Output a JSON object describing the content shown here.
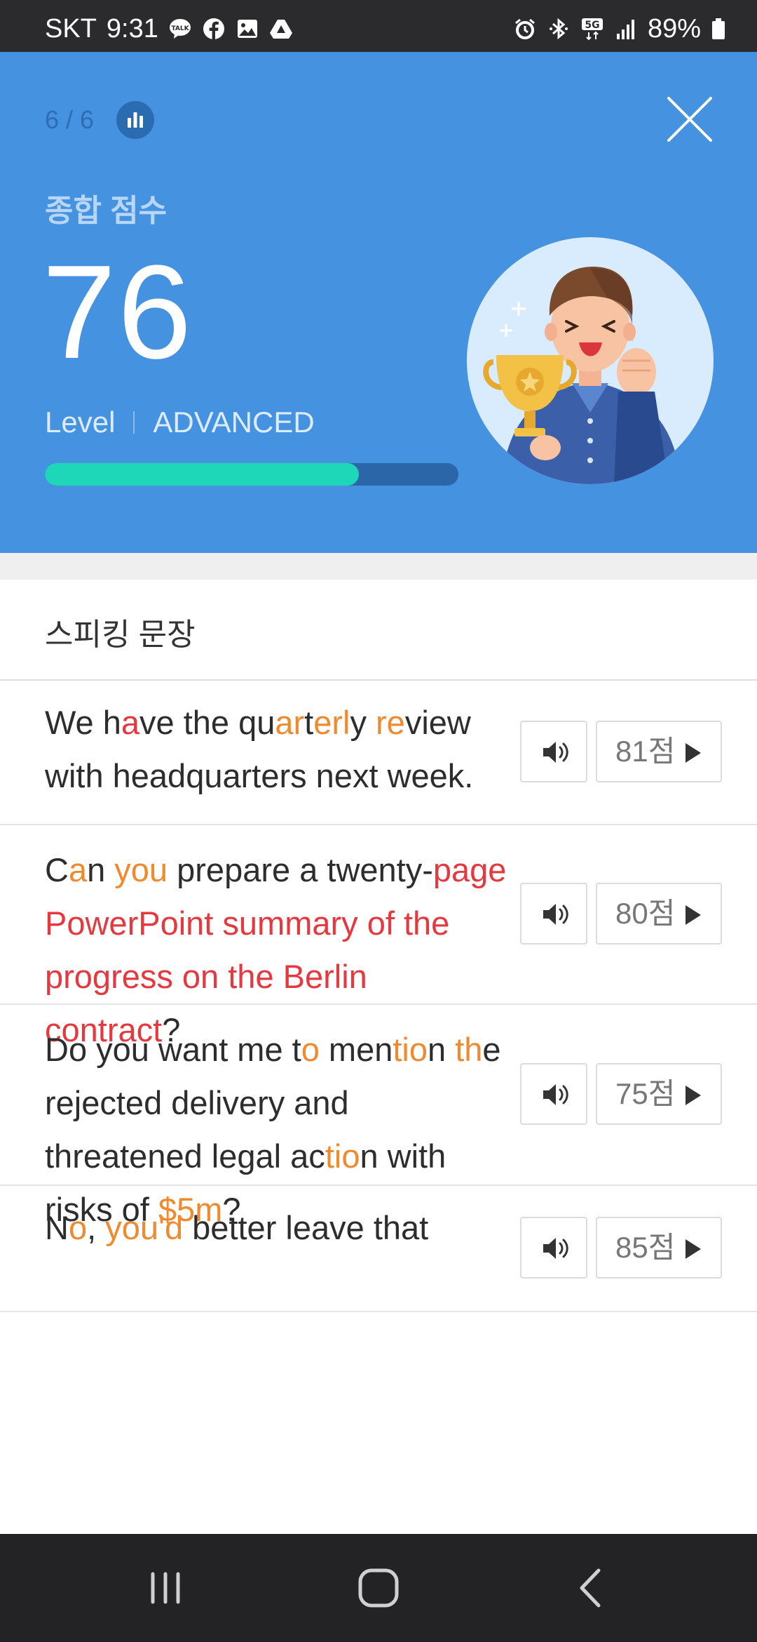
{
  "status_bar": {
    "carrier": "SKT",
    "time": "9:31",
    "left_icons": [
      "talk-icon",
      "facebook-icon",
      "gallery-icon",
      "drive-icon"
    ],
    "right_icons": [
      "alarm-icon",
      "bluetooth-icon",
      "5g-icon",
      "signal-icon"
    ],
    "battery": "89%"
  },
  "header": {
    "progress": "6 / 6",
    "score_label": "종합 점수",
    "score": "76",
    "level_label": "Level",
    "level_value": "ADVANCED",
    "level_progress": 0.76,
    "colors": {
      "background": "#4592e1",
      "progress_fill": "#1ed6b8",
      "progress_track": "#2a66a8"
    }
  },
  "section": {
    "title": "스피킹 문장"
  },
  "sentences": [
    {
      "segments": [
        {
          "t": "We h",
          "c": "n"
        },
        {
          "t": "a",
          "c": "r"
        },
        {
          "t": "ve the qu",
          "c": "n"
        },
        {
          "t": "ar",
          "c": "o"
        },
        {
          "t": "t",
          "c": "n"
        },
        {
          "t": "erl",
          "c": "o"
        },
        {
          "t": "y ",
          "c": "n"
        },
        {
          "t": "re",
          "c": "o"
        },
        {
          "t": "view with headquarters next week.",
          "c": "n"
        }
      ],
      "score": "81점"
    },
    {
      "segments": [
        {
          "t": "C",
          "c": "n"
        },
        {
          "t": "a",
          "c": "o"
        },
        {
          "t": "n ",
          "c": "n"
        },
        {
          "t": "you",
          "c": "o"
        },
        {
          "t": " prepare a twenty-",
          "c": "n"
        },
        {
          "t": "page PowerPoint summary of the progress on the Berlin contract",
          "c": "r"
        },
        {
          "t": "?",
          "c": "n"
        }
      ],
      "score": "80점"
    },
    {
      "segments": [
        {
          "t": "Do you want me t",
          "c": "n"
        },
        {
          "t": "o",
          "c": "o"
        },
        {
          "t": " men",
          "c": "n"
        },
        {
          "t": "tio",
          "c": "o"
        },
        {
          "t": "n ",
          "c": "n"
        },
        {
          "t": "th",
          "c": "o"
        },
        {
          "t": "e rejected delivery and threatened legal ac",
          "c": "n"
        },
        {
          "t": "tio",
          "c": "o"
        },
        {
          "t": "n with risks of ",
          "c": "n"
        },
        {
          "t": "$5m",
          "c": "o"
        },
        {
          "t": "?",
          "c": "n"
        }
      ],
      "score": "75점"
    },
    {
      "segments": [
        {
          "t": "N",
          "c": "n"
        },
        {
          "t": "o",
          "c": "o"
        },
        {
          "t": ", ",
          "c": "n"
        },
        {
          "t": "you'd",
          "c": "o"
        },
        {
          "t": " better leave that",
          "c": "n"
        }
      ],
      "score": "85점"
    }
  ],
  "nav_bar": {
    "buttons": [
      "recents-icon",
      "home-icon",
      "back-icon"
    ]
  }
}
